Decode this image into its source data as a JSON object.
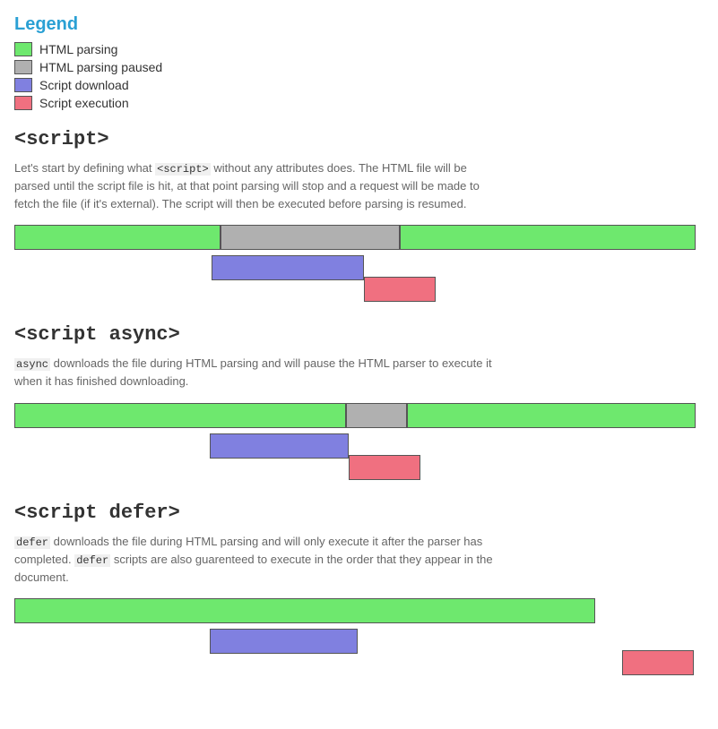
{
  "legend": {
    "title": "Legend",
    "items": [
      {
        "label": "HTML parsing",
        "color": "html-parsing"
      },
      {
        "label": "HTML parsing paused",
        "color": "html-paused"
      },
      {
        "label": "Script download",
        "color": "script-download"
      },
      {
        "label": "Script execution",
        "color": "script-execution"
      }
    ]
  },
  "sections": [
    {
      "id": "script",
      "heading": "<script>",
      "description_parts": [
        {
          "text": "Let's start by defining what ",
          "type": "normal"
        },
        {
          "text": "<script>",
          "type": "code"
        },
        {
          "text": " without any attributes does. The HTML file will be parsed until the script file is hit, at that point parsing will stop and a request will be made to fetch the file (if it's external). The script will then be executed before parsing is resumed.",
          "type": "normal"
        }
      ]
    },
    {
      "id": "script-async",
      "heading": "<script async>",
      "description_parts": [
        {
          "text": "async",
          "type": "keyword-orange"
        },
        {
          "text": " downloads the file during HTML parsing and will pause the HTML parser to execute it when it has finished downloading.",
          "type": "normal"
        }
      ]
    },
    {
      "id": "script-defer",
      "heading": "<script defer>",
      "description_parts": [
        {
          "text": "defer",
          "type": "keyword-orange"
        },
        {
          "text": " downloads the file during HTML parsing and will only execute it after the parser has completed. ",
          "type": "normal"
        },
        {
          "text": "defer",
          "type": "code"
        },
        {
          "text": " scripts are also guarenteed to execute in the order that they appear in the document.",
          "type": "normal"
        }
      ]
    }
  ]
}
